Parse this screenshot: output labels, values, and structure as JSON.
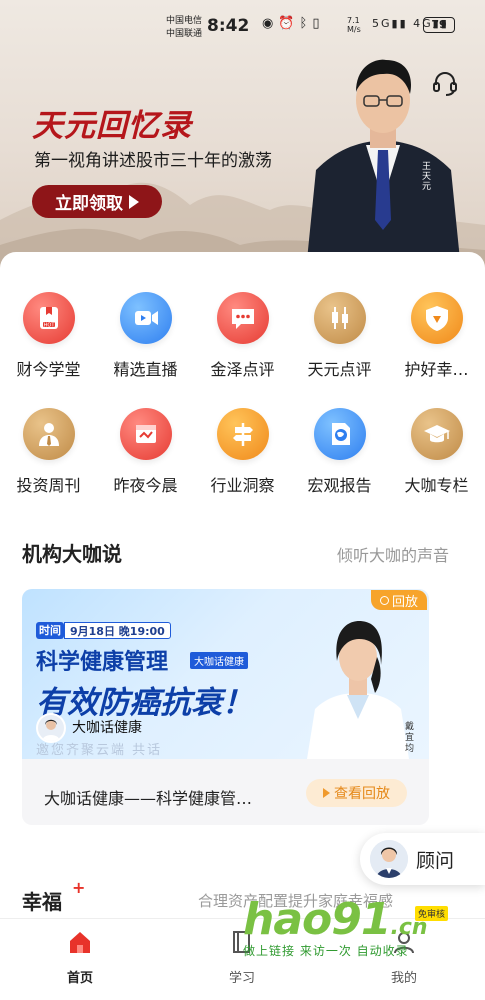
{
  "status_bar": {
    "carrier_1": "中国电信",
    "carrier_2": "中国联通",
    "time": "8:42",
    "net_speed": "7.1\nM/s",
    "battery": "79"
  },
  "hero": {
    "title": "天元回忆录",
    "subtitle": "第一视角讲述股市三十年的激荡",
    "cta": "立即领取",
    "signature": "王天元"
  },
  "grid": [
    {
      "label": "财今学堂",
      "icon": "hot-book-icon",
      "color": "red"
    },
    {
      "label": "精选直播",
      "icon": "video-camera-icon",
      "color": "blue"
    },
    {
      "label": "金泽点评",
      "icon": "chat-bubble-icon",
      "color": "red"
    },
    {
      "label": "天元点评",
      "icon": "candlestick-icon",
      "color": "gold"
    },
    {
      "label": "护好幸…",
      "icon": "shield-icon",
      "color": "orange"
    },
    {
      "label": "投资周刊",
      "icon": "businessman-icon",
      "color": "gold"
    },
    {
      "label": "昨夜今晨",
      "icon": "newspaper-icon",
      "color": "red"
    },
    {
      "label": "行业洞察",
      "icon": "signpost-icon",
      "color": "orange"
    },
    {
      "label": "宏观报告",
      "icon": "globe-report-icon",
      "color": "blue"
    },
    {
      "label": "大咖专栏",
      "icon": "graduation-cap-icon",
      "color": "gold"
    }
  ],
  "section1": {
    "title": "机构大咖说",
    "more": "倾听大咖的声音"
  },
  "card": {
    "replay_badge": "回放",
    "time_tag": "时间",
    "time_text": "9月18日 晚19:00",
    "headline": "科学健康管理",
    "chip": "大咖话健康",
    "big_headline": "有效防癌抗衰！",
    "brand": "大咖话健康",
    "slogan": "邀您齐聚云端  共话",
    "title": "大咖话健康——科学健康管…",
    "button": "查看回放"
  },
  "consult": {
    "label": "顾问"
  },
  "section2": {
    "title": "幸福",
    "plus": "+",
    "subtitle": "合理资产配置提升家庭幸福感"
  },
  "nav": [
    {
      "label": "首页",
      "icon": "home-icon",
      "active": true
    },
    {
      "label": "学习",
      "icon": "book-icon",
      "active": false
    },
    {
      "label": "我的",
      "icon": "profile-icon",
      "active": false
    }
  ],
  "watermark": {
    "logo": "hao91",
    "suffix": ".cn",
    "badge": "免审核",
    "text": "做上链接 来访一次 自动收录"
  },
  "colors": {
    "brand_red": "#b5161b",
    "cta_red": "#8e1518",
    "accent_orange": "#f09a2d",
    "link_blue": "#0d3fa8"
  }
}
